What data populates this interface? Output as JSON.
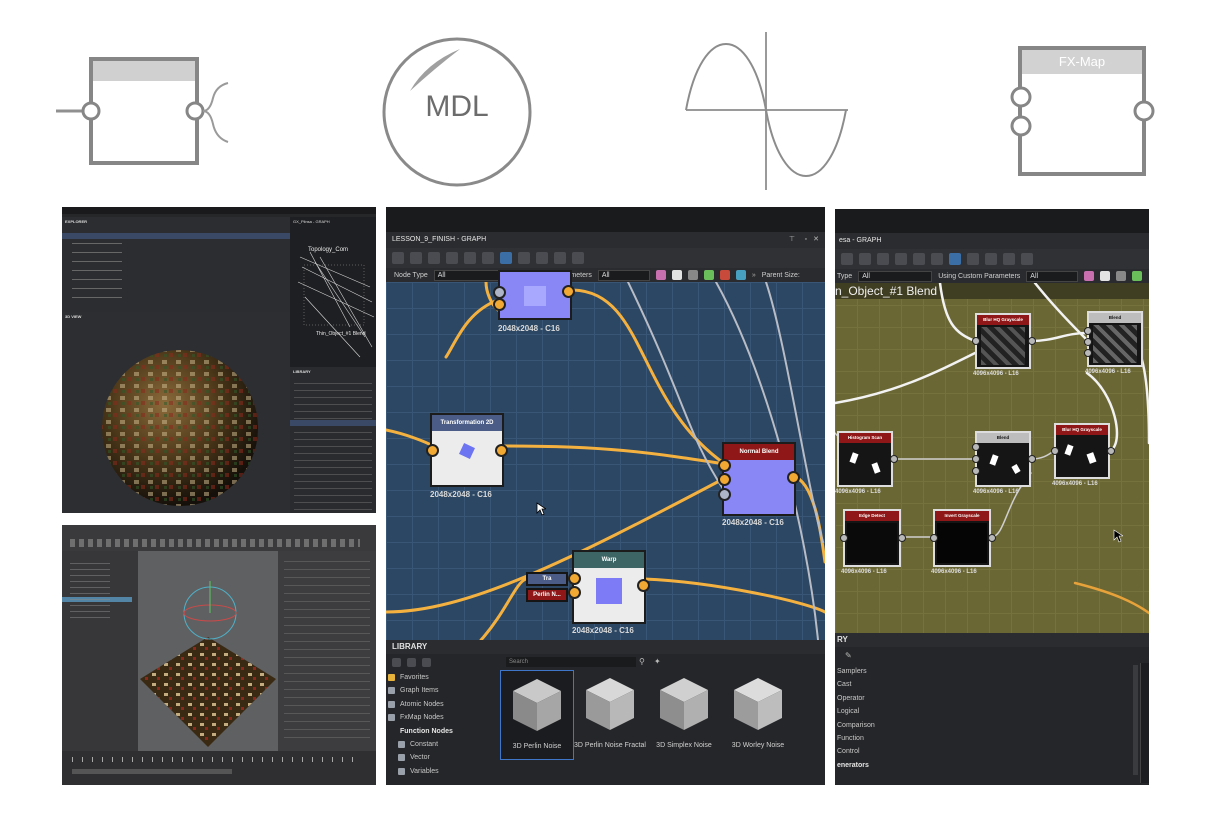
{
  "icons": {
    "mdl_label": "MDL",
    "fxmap_label": "FX-Map"
  },
  "explorer_screenshot": {
    "explorer_title": "EXPLORER",
    "graph_title": "GX_Plinsa - GRAPH",
    "view3d_title": "3D VIEW",
    "library_title": "LIBRARY",
    "topology_label": "Topology_Com",
    "thin_object_label": "Thin_Object_#1 Blend"
  },
  "graph_window": {
    "title": "LESSON_9_FINISH - GRAPH",
    "node_type_label": "Node Type",
    "node_type_value": "All",
    "custom_params_label": "Using Custom Parameters",
    "custom_params_value": "All",
    "parent_size_label": "Parent Size:",
    "nodes": {
      "top_size": "2048x2048 - C16",
      "transformation_title": "Transformation 2D",
      "transformation_size": "2048x2048 - C16",
      "normal_blend_title": "Normal Blend",
      "normal_blend_size": "2048x2048 - C16",
      "warp_title": "Warp",
      "warp_size": "2048x2048 - C16",
      "tra_label": "Tra",
      "perlin_label": "Perlin N..."
    }
  },
  "library": {
    "title": "LIBRARY",
    "search_placeholder": "Search",
    "items": [
      {
        "label": "Favorites",
        "icon": "star-icon"
      },
      {
        "label": "Graph Items",
        "icon": "graph-items-icon"
      },
      {
        "label": "Atomic Nodes",
        "icon": "atomic-nodes-icon"
      },
      {
        "label": "FxMap Nodes",
        "icon": "fxmap-nodes-icon"
      },
      {
        "label": "Function Nodes",
        "icon": "function-nodes-icon"
      },
      {
        "label": "Constant",
        "icon": "constant-icon"
      },
      {
        "label": "Vector",
        "icon": "vector-icon"
      },
      {
        "label": "Variables",
        "icon": "variables-icon"
      }
    ],
    "tiles": [
      "3D Perlin Noise",
      "3D Perlin Noise Fractal",
      "3D Simplex Noise",
      "3D Worley Noise"
    ]
  },
  "right_graph": {
    "title_fragment": "esa - GRAPH",
    "node_type_label": "Type",
    "node_type_value": "All",
    "custom_params_label": "Using Custom Parameters",
    "custom_params_value": "All",
    "graph_title": "n_Object_#1 Blend",
    "nodes": [
      {
        "title": "Blur HQ Grayscale",
        "size": "4096x4096 - L16"
      },
      {
        "title": "Blend",
        "size": "4096x4096 - L16"
      },
      {
        "title": "Histogram Scan",
        "size": "4096x4096 - L16"
      },
      {
        "title": "Blend",
        "size": "4096x4096 - L16"
      },
      {
        "title": "Blur HQ Grayscale",
        "size": "4096x4096 - L16"
      },
      {
        "title": "Edge Detect",
        "size": "4096x4096 - L16"
      },
      {
        "title": "Invert Grayscale",
        "size": "4096x4096 - L16"
      }
    ],
    "library_fragment": "RY",
    "library_items": [
      "Samplers",
      "Cast",
      "Operator",
      "Logical",
      "Comparison",
      "Function",
      "Control",
      "enerators"
    ]
  },
  "colors": {
    "graph_bg": "#2c4763",
    "node_header_red": "#8f1717",
    "node_header_blue": "#4b5c86",
    "node_header_teal": "#3d6565",
    "wire_orange": "#f4b13f",
    "pattern_bg": "#6b6734"
  }
}
